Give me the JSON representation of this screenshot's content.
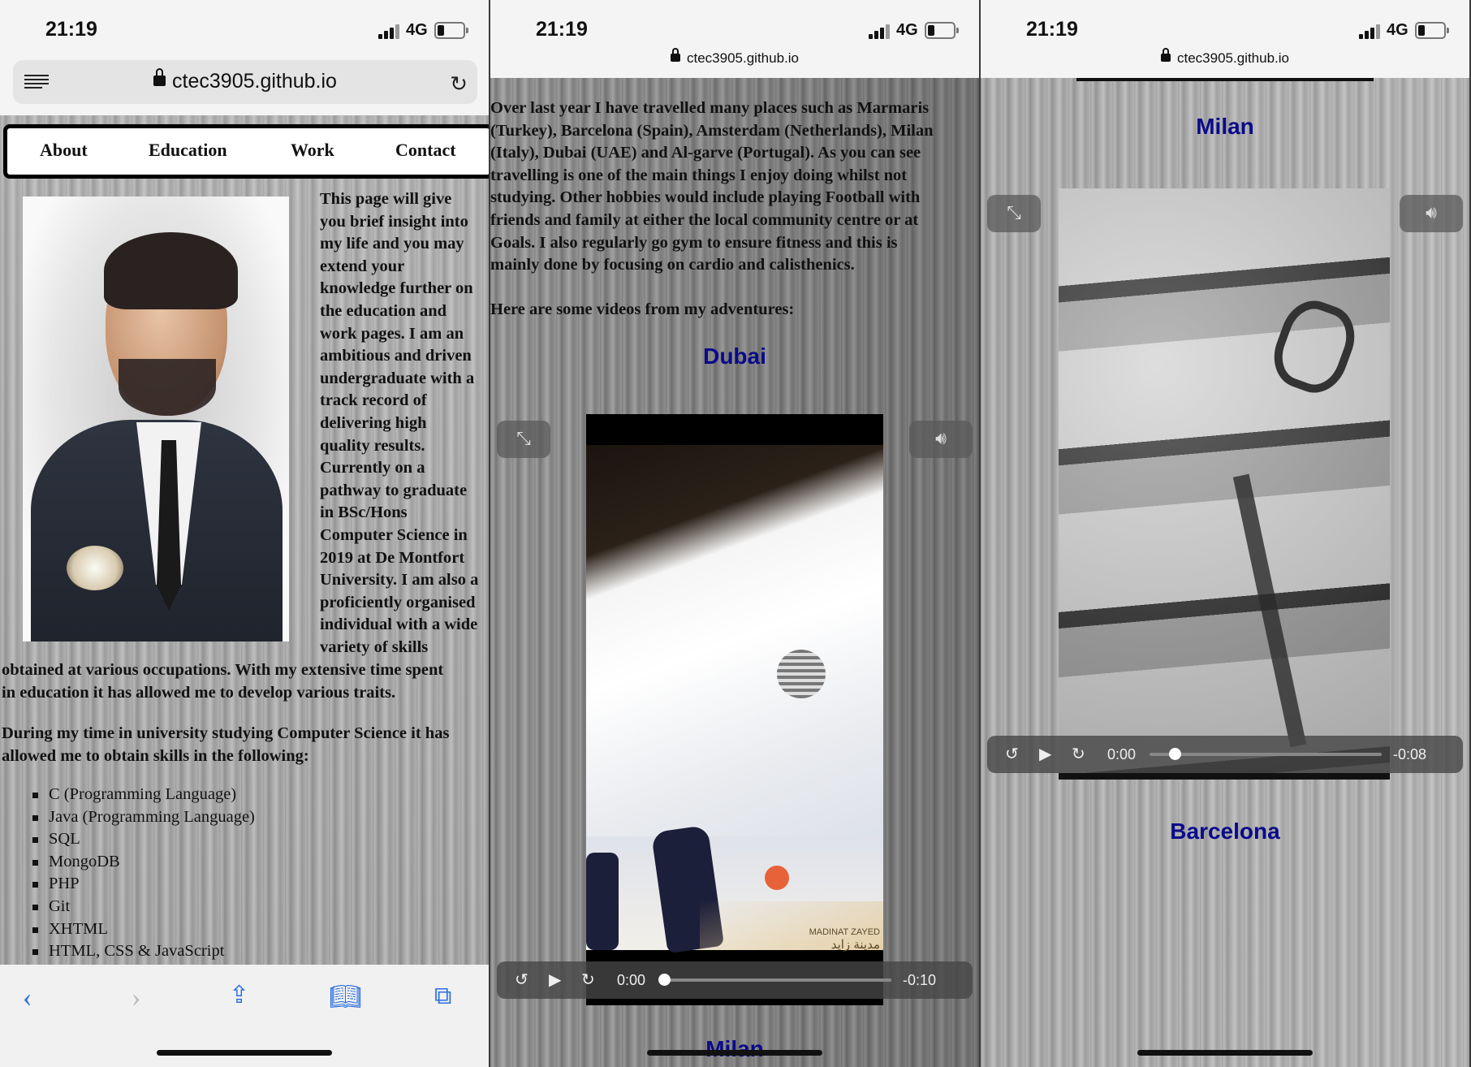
{
  "status": {
    "time": "21:19",
    "network": "4G"
  },
  "browser": {
    "url": "ctec3905.github.io"
  },
  "nav": {
    "items": [
      "About",
      "Education",
      "Work",
      "Contact"
    ]
  },
  "about": {
    "intro_lines": [
      "This page will give",
      "you brief insight into",
      "my life and you may",
      "extend your",
      "knowledge further on",
      "the education and",
      "work pages. I am an",
      "ambitious and driven",
      "undergraduate with a",
      "track record of",
      "delivering high",
      "quality results.",
      "Currently on a",
      "pathway to graduate",
      "in BSc/Hons",
      "Computer Science in",
      "2019 at De Montfort",
      "University. I am also a",
      "proficiently organised",
      "individual with a wide",
      "variety of skills"
    ],
    "wrap_lines": [
      "obtained at various occupations. With my extensive time spent",
      "in education it has allowed me to develop various traits."
    ],
    "skills_intro_lines": [
      "During my time in university studying Computer Science it has",
      "allowed me to obtain skills in the following:"
    ],
    "skills": [
      "C (Programming Language)",
      "Java (Programming Language)",
      "SQL",
      "MongoDB",
      "PHP",
      "Git",
      "XHTML",
      "HTML, CSS & JavaScript"
    ]
  },
  "travel": {
    "paragraph_lines": [
      "Over last year I have travelled many places such as Marmaris",
      "(Turkey), Barcelona (Spain), Amsterdam (Netherlands), Milan",
      "(Italy), Dubai (UAE) and Al-garve (Portugal). As you can see",
      "travelling is one of the main things I enjoy doing whilst not",
      "studying. Other hobbies would include playing Football with",
      "friends and family at either the local community centre or at",
      "Goals. I also regularly go gym to ensure fitness and this is",
      "mainly done by focusing on cardio and calisthenics."
    ],
    "videos_intro": "Here are some videos from my adventures:"
  },
  "videos": {
    "dubai": {
      "title": "Dubai",
      "current": "0:00",
      "remaining": "-0:10",
      "progress": 0.0
    },
    "milan": {
      "title": "Milan",
      "current": "0:00",
      "remaining": "-0:08",
      "progress": 0.0
    },
    "barcelona": {
      "title": "Barcelona"
    }
  },
  "video_overlay": {
    "watermark_latin": "MADINAT ZAYED",
    "watermark_arabic": "مدينة زايد"
  }
}
